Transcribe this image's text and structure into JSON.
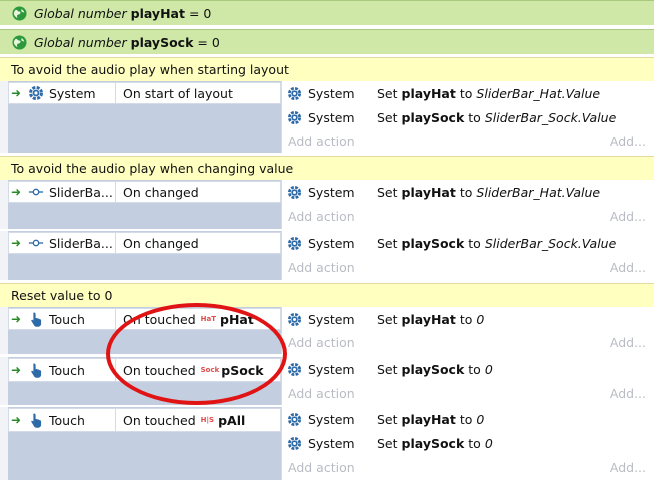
{
  "globals": [
    {
      "prefix": "Global number",
      "name": "playHat",
      "value": "= 0"
    },
    {
      "prefix": "Global number",
      "name": "playSock",
      "value": "= 0"
    }
  ],
  "comments": [
    "To avoid the audio play when starting layout",
    "To avoid the audio play when changing value",
    "Reset value to 0"
  ],
  "events": [
    {
      "object": "System",
      "condition": "On start of layout",
      "condition_object": "",
      "actions": [
        {
          "object": "System",
          "verb": "Set",
          "var": "playHat",
          "to": "to",
          "value": "SliderBar_Hat.Value"
        },
        {
          "object": "System",
          "verb": "Set",
          "var": "playSock",
          "to": "to",
          "value": "SliderBar_Sock.Value"
        }
      ]
    },
    {
      "object": "SliderBa...",
      "condition": "On changed",
      "condition_object": "",
      "actions": [
        {
          "object": "System",
          "verb": "Set",
          "var": "playHat",
          "to": "to",
          "value": "SliderBar_Hat.Value"
        }
      ]
    },
    {
      "object": "SliderBa...",
      "condition": "On changed",
      "condition_object": "",
      "actions": [
        {
          "object": "System",
          "verb": "Set",
          "var": "playSock",
          "to": "to",
          "value": "SliderBar_Sock.Value"
        }
      ]
    },
    {
      "object": "Touch",
      "condition": "On touched",
      "condition_object": "pHat",
      "sprite_label": "HaT",
      "actions": [
        {
          "object": "System",
          "verb": "Set",
          "var": "playHat",
          "to": "to",
          "value": "0"
        }
      ]
    },
    {
      "object": "Touch",
      "condition": "On touched",
      "condition_object": "pSock",
      "sprite_label": "Sock",
      "actions": [
        {
          "object": "System",
          "verb": "Set",
          "var": "playSock",
          "to": "to",
          "value": "0"
        }
      ]
    },
    {
      "object": "Touch",
      "condition": "On touched",
      "condition_object": "pAll",
      "sprite_label": "H|S",
      "actions": [
        {
          "object": "System",
          "verb": "Set",
          "var": "playHat",
          "to": "to",
          "value": "0"
        },
        {
          "object": "System",
          "verb": "Set",
          "var": "playSock",
          "to": "to",
          "value": "0"
        }
      ]
    }
  ],
  "add_action_label": "Add action",
  "add_label": "Add...",
  "icons": {
    "global": "globe-icon",
    "system": "gear-icon",
    "slider": "slider-icon",
    "touch": "touch-hand-icon",
    "arrow": "green-arrow-icon"
  },
  "colors": {
    "global_bg": "#cfe8a8",
    "comment_bg": "#ffffc0",
    "condition_area": "#c3cfe1",
    "highlight_circle": "#e01414"
  }
}
